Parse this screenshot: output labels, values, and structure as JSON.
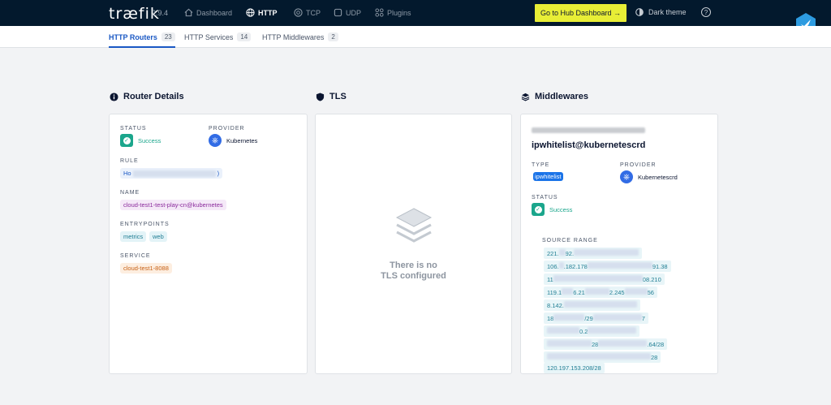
{
  "app": {
    "logo": "træfik",
    "version": "2.9.4"
  },
  "nav": {
    "dashboard": "Dashboard",
    "http": "HTTP",
    "tcp": "TCP",
    "udp": "UDP",
    "plugins": "Plugins",
    "hub_button": "Go to Hub Dashboard →",
    "theme": "Dark theme",
    "help": "?"
  },
  "tabs": [
    {
      "label": "HTTP Routers",
      "count": "23"
    },
    {
      "label": "HTTP Services",
      "count": "14"
    },
    {
      "label": "HTTP Middlewares",
      "count": "2"
    }
  ],
  "router": {
    "title": "Router Details",
    "status_label": "STATUS",
    "status_value": "Success",
    "provider_label": "PROVIDER",
    "provider_value": "Kubernetes",
    "rule_label": "RULE",
    "rule_prefix": "Ho",
    "rule_suffix": ")",
    "name_label": "NAME",
    "name_value": "cloud-test1-test-play-cn@kubernetes",
    "entrypoints_label": "ENTRYPOINTS",
    "entrypoints": [
      "metrics",
      "web"
    ],
    "service_label": "SERVICE",
    "service_value": "cloud-test1-8088"
  },
  "tls": {
    "title": "TLS",
    "empty_line1": "There is no",
    "empty_line2": "TLS configured"
  },
  "middlewares": {
    "title": "Middlewares",
    "name": "ipwhitelist@kubernetescrd",
    "type_label": "TYPE",
    "type_value": "ipwhitelist",
    "provider_label": "PROVIDER",
    "provider_value": "Kubernetescrd",
    "status_label": "STATUS",
    "status_value": "Success",
    "source_range_label": "SOURCE RANGE",
    "ranges": [
      {
        "a": "221.",
        "b": "92."
      },
      {
        "a": "106.",
        "b": ".182.178",
        "c": "91.38"
      },
      {
        "a": "11",
        "b": "",
        "c": "08.210"
      },
      {
        "a": "119.1",
        "b": "6.21",
        "c": "2.245",
        "d": "56"
      },
      {
        "a": "8.142.",
        "b": ""
      },
      {
        "a": "18",
        "b": "/29",
        "c": "7"
      },
      {
        "a": "",
        "b": "0.2"
      },
      {
        "a": "",
        "b": "28",
        "c": ".64/28"
      },
      {
        "a": "",
        "b": "",
        "c": "28"
      },
      {
        "a": "120.197.153.208/28",
        "b": ""
      }
    ]
  }
}
